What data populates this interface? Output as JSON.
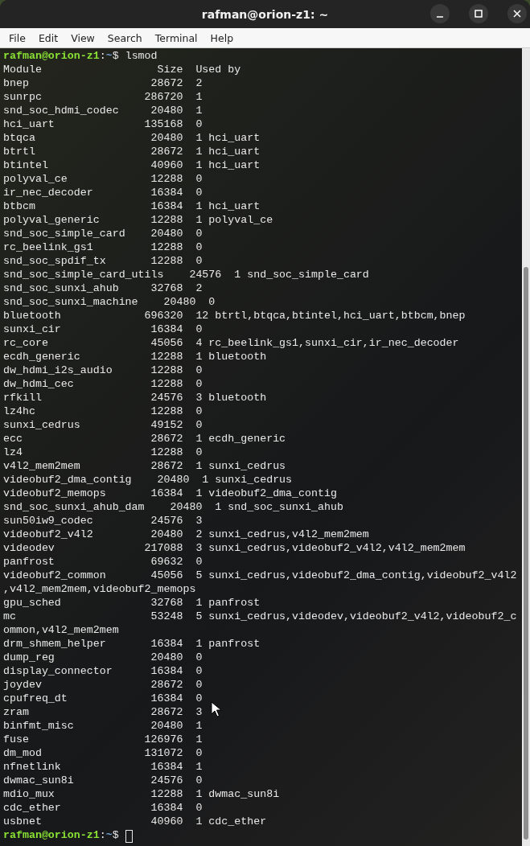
{
  "window": {
    "title": "rafman@orion-z1: ~"
  },
  "menu_bar": [
    "File",
    "Edit",
    "View",
    "Search",
    "Terminal",
    "Help"
  ],
  "terminal": {
    "command_prompt": {
      "user_host": "rafman@orion-z1",
      "separator": ":",
      "path": "~",
      "symbol": "$",
      "command": "lsmod"
    },
    "output_lines": [
      "Module                  Size  Used by",
      "bnep                   28672  2",
      "sunrpc                286720  1",
      "snd_soc_hdmi_codec     20480  1",
      "hci_uart              135168  0",
      "btqca                  20480  1 hci_uart",
      "btrtl                  28672  1 hci_uart",
      "btintel                40960  1 hci_uart",
      "polyval_ce             12288  0",
      "ir_nec_decoder         16384  0",
      "btbcm                  16384  1 hci_uart",
      "polyval_generic        12288  1 polyval_ce",
      "snd_soc_simple_card    20480  0",
      "rc_beelink_gs1         12288  0",
      "snd_soc_spdif_tx       12288  0",
      "snd_soc_simple_card_utils    24576  1 snd_soc_simple_card",
      "snd_soc_sunxi_ahub     32768  2",
      "snd_soc_sunxi_machine    20480  0",
      "bluetooth             696320  12 btrtl,btqca,btintel,hci_uart,btbcm,bnep",
      "sunxi_cir              16384  0",
      "rc_core                45056  4 rc_beelink_gs1,sunxi_cir,ir_nec_decoder",
      "ecdh_generic           12288  1 bluetooth",
      "dw_hdmi_i2s_audio      12288  0",
      "dw_hdmi_cec            12288  0",
      "rfkill                 24576  3 bluetooth",
      "lz4hc                  12288  0",
      "sunxi_cedrus           49152  0",
      "ecc                    28672  1 ecdh_generic",
      "lz4                    12288  0",
      "v4l2_mem2mem           28672  1 sunxi_cedrus",
      "videobuf2_dma_contig    20480  1 sunxi_cedrus",
      "videobuf2_memops       16384  1 videobuf2_dma_contig",
      "snd_soc_sunxi_ahub_dam    20480  1 snd_soc_sunxi_ahub",
      "sun50iw9_codec         24576  3",
      "videobuf2_v4l2         20480  2 sunxi_cedrus,v4l2_mem2mem",
      "videodev              217088  3 sunxi_cedrus,videobuf2_v4l2,v4l2_mem2mem",
      "panfrost               69632  0",
      "videobuf2_common       45056  5 sunxi_cedrus,videobuf2_dma_contig,videobuf2_v4l2",
      ",v4l2_mem2mem,videobuf2_memops",
      "gpu_sched              32768  1 panfrost",
      "mc                     53248  5 sunxi_cedrus,videodev,videobuf2_v4l2,videobuf2_c",
      "ommon,v4l2_mem2mem",
      "drm_shmem_helper       16384  1 panfrost",
      "dump_reg               20480  0",
      "display_connector      16384  0",
      "joydev                 28672  0",
      "cpufreq_dt             16384  0",
      "zram                   28672  3",
      "binfmt_misc            20480  1",
      "fuse                  126976  1",
      "dm_mod                131072  0",
      "nfnetlink              16384  1",
      "dwmac_sun8i            24576  0",
      "mdio_mux               12288  1 dwmac_sun8i",
      "cdc_ether              16384  0",
      "usbnet                 40960  1 cdc_ether"
    ],
    "final_prompt": {
      "user_host": "rafman@orion-z1",
      "separator": ":",
      "path": "~",
      "symbol": "$"
    }
  }
}
